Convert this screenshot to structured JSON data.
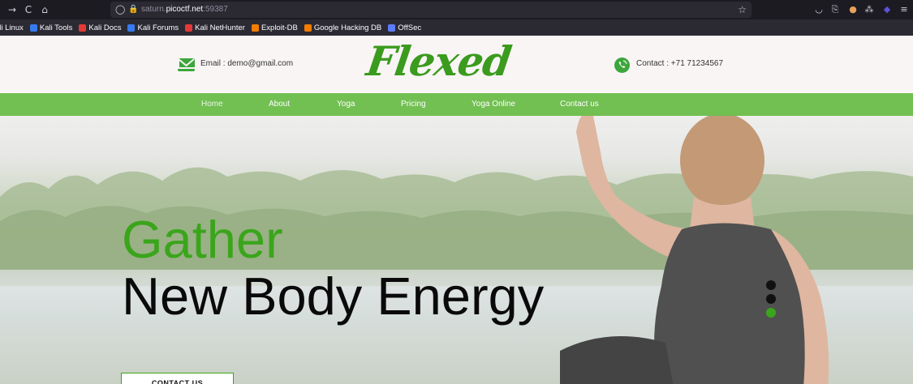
{
  "browser": {
    "url_prefix": "saturn.",
    "url_domain": "picoctf.net",
    "url_suffix": ":59387",
    "nav_icons": [
      "back-arrow-icon",
      "reload-icon",
      "home-icon"
    ],
    "bookmarks": [
      {
        "label": "ali Linux",
        "color": "#3b5bdb"
      },
      {
        "label": "Kali Tools",
        "color": "#367bf0"
      },
      {
        "label": "Kali Docs",
        "color": "#e53935"
      },
      {
        "label": "Kali Forums",
        "color": "#367bf0"
      },
      {
        "label": "Kali NetHunter",
        "color": "#e53935"
      },
      {
        "label": "Exploit-DB",
        "color": "#f57c00"
      },
      {
        "label": "Google Hacking DB",
        "color": "#f57c00"
      },
      {
        "label": "OffSec",
        "color": "#5c7cfa"
      }
    ]
  },
  "site": {
    "email": "Email : demo@gmail.com",
    "logo": "Flexed",
    "contact": "Contact : +71 71234567",
    "nav": [
      "Home",
      "About",
      "Yoga",
      "Pricing",
      "Yoga Online",
      "Contact us"
    ],
    "headline_green": "Gather",
    "headline_black": "New Body Energy",
    "cta": "CONTACT US",
    "colors": {
      "green": "#3aa51b",
      "navbar": "#72bf52",
      "text": "#0a0a0a"
    },
    "slider": {
      "total": 3,
      "active_index": 2
    }
  }
}
